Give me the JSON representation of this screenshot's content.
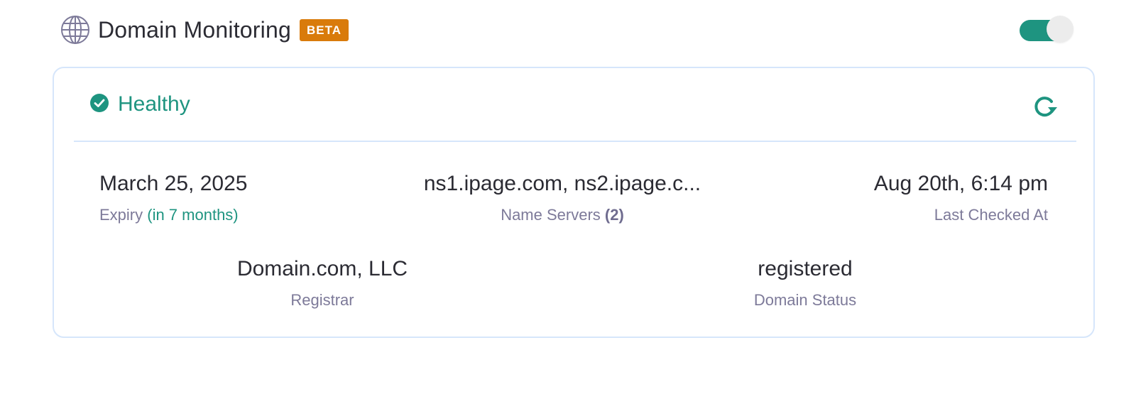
{
  "header": {
    "icon": "globe-icon",
    "title": "Domain Monitoring",
    "badge": "BETA",
    "toggle_on": true
  },
  "colors": {
    "accent": "#1e9480",
    "badge": "#d97b0b",
    "border": "#d6e6fb",
    "label": "#7d7a99"
  },
  "card": {
    "status": {
      "icon": "check-circle-icon",
      "label": "Healthy"
    },
    "refresh_icon": "refresh-icon",
    "expiry": {
      "value": "March 25, 2025",
      "label": "Expiry",
      "relative": "(in 7 months)"
    },
    "name_servers": {
      "value": "ns1.ipage.com, ns2.ipage.c...",
      "label": "Name Servers",
      "count": "(2)"
    },
    "last_checked": {
      "value": "Aug 20th, 6:14 pm",
      "label": "Last Checked At"
    },
    "registrar": {
      "value": "Domain.com, LLC",
      "label": "Registrar"
    },
    "domain_status": {
      "value": "registered",
      "label": "Domain Status"
    }
  }
}
